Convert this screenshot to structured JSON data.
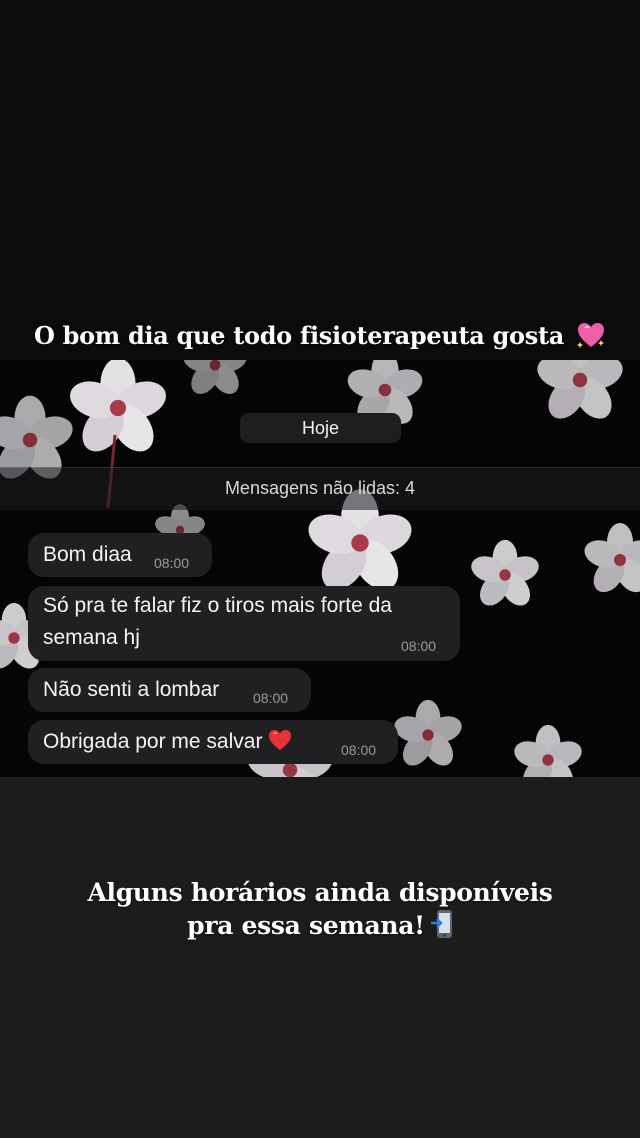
{
  "story": {
    "caption_top": "O bom dia que todo fisioterapeuta gosta",
    "caption_top_emoji": "sparkling-heart-icon",
    "caption_bottom_line1": "Alguns horários ainda disponíveis",
    "caption_bottom_line2": "pra essa semana!",
    "caption_bottom_emoji": "mobile-phone-arrow-icon"
  },
  "chat": {
    "date_label": "Hoje",
    "unread_label": "Mensagens não lidas: 4",
    "messages": [
      {
        "text": "Bom diaa",
        "time": "08:00"
      },
      {
        "text_line1": "Só pra te falar fiz o tiros mais forte da",
        "text_line2": "semana hj",
        "time": "08:00"
      },
      {
        "text": "Não senti a lombar",
        "time": "08:00"
      },
      {
        "text": "Obrigada por me salvar",
        "emoji": "red-heart-icon",
        "time": "08:00"
      }
    ]
  },
  "colors": {
    "background": "#0b0b0c",
    "bottom_background": "#1c1c1d",
    "bubble": "#202022",
    "timestamp": "#9a9a9c",
    "heart": "#e8313b"
  }
}
